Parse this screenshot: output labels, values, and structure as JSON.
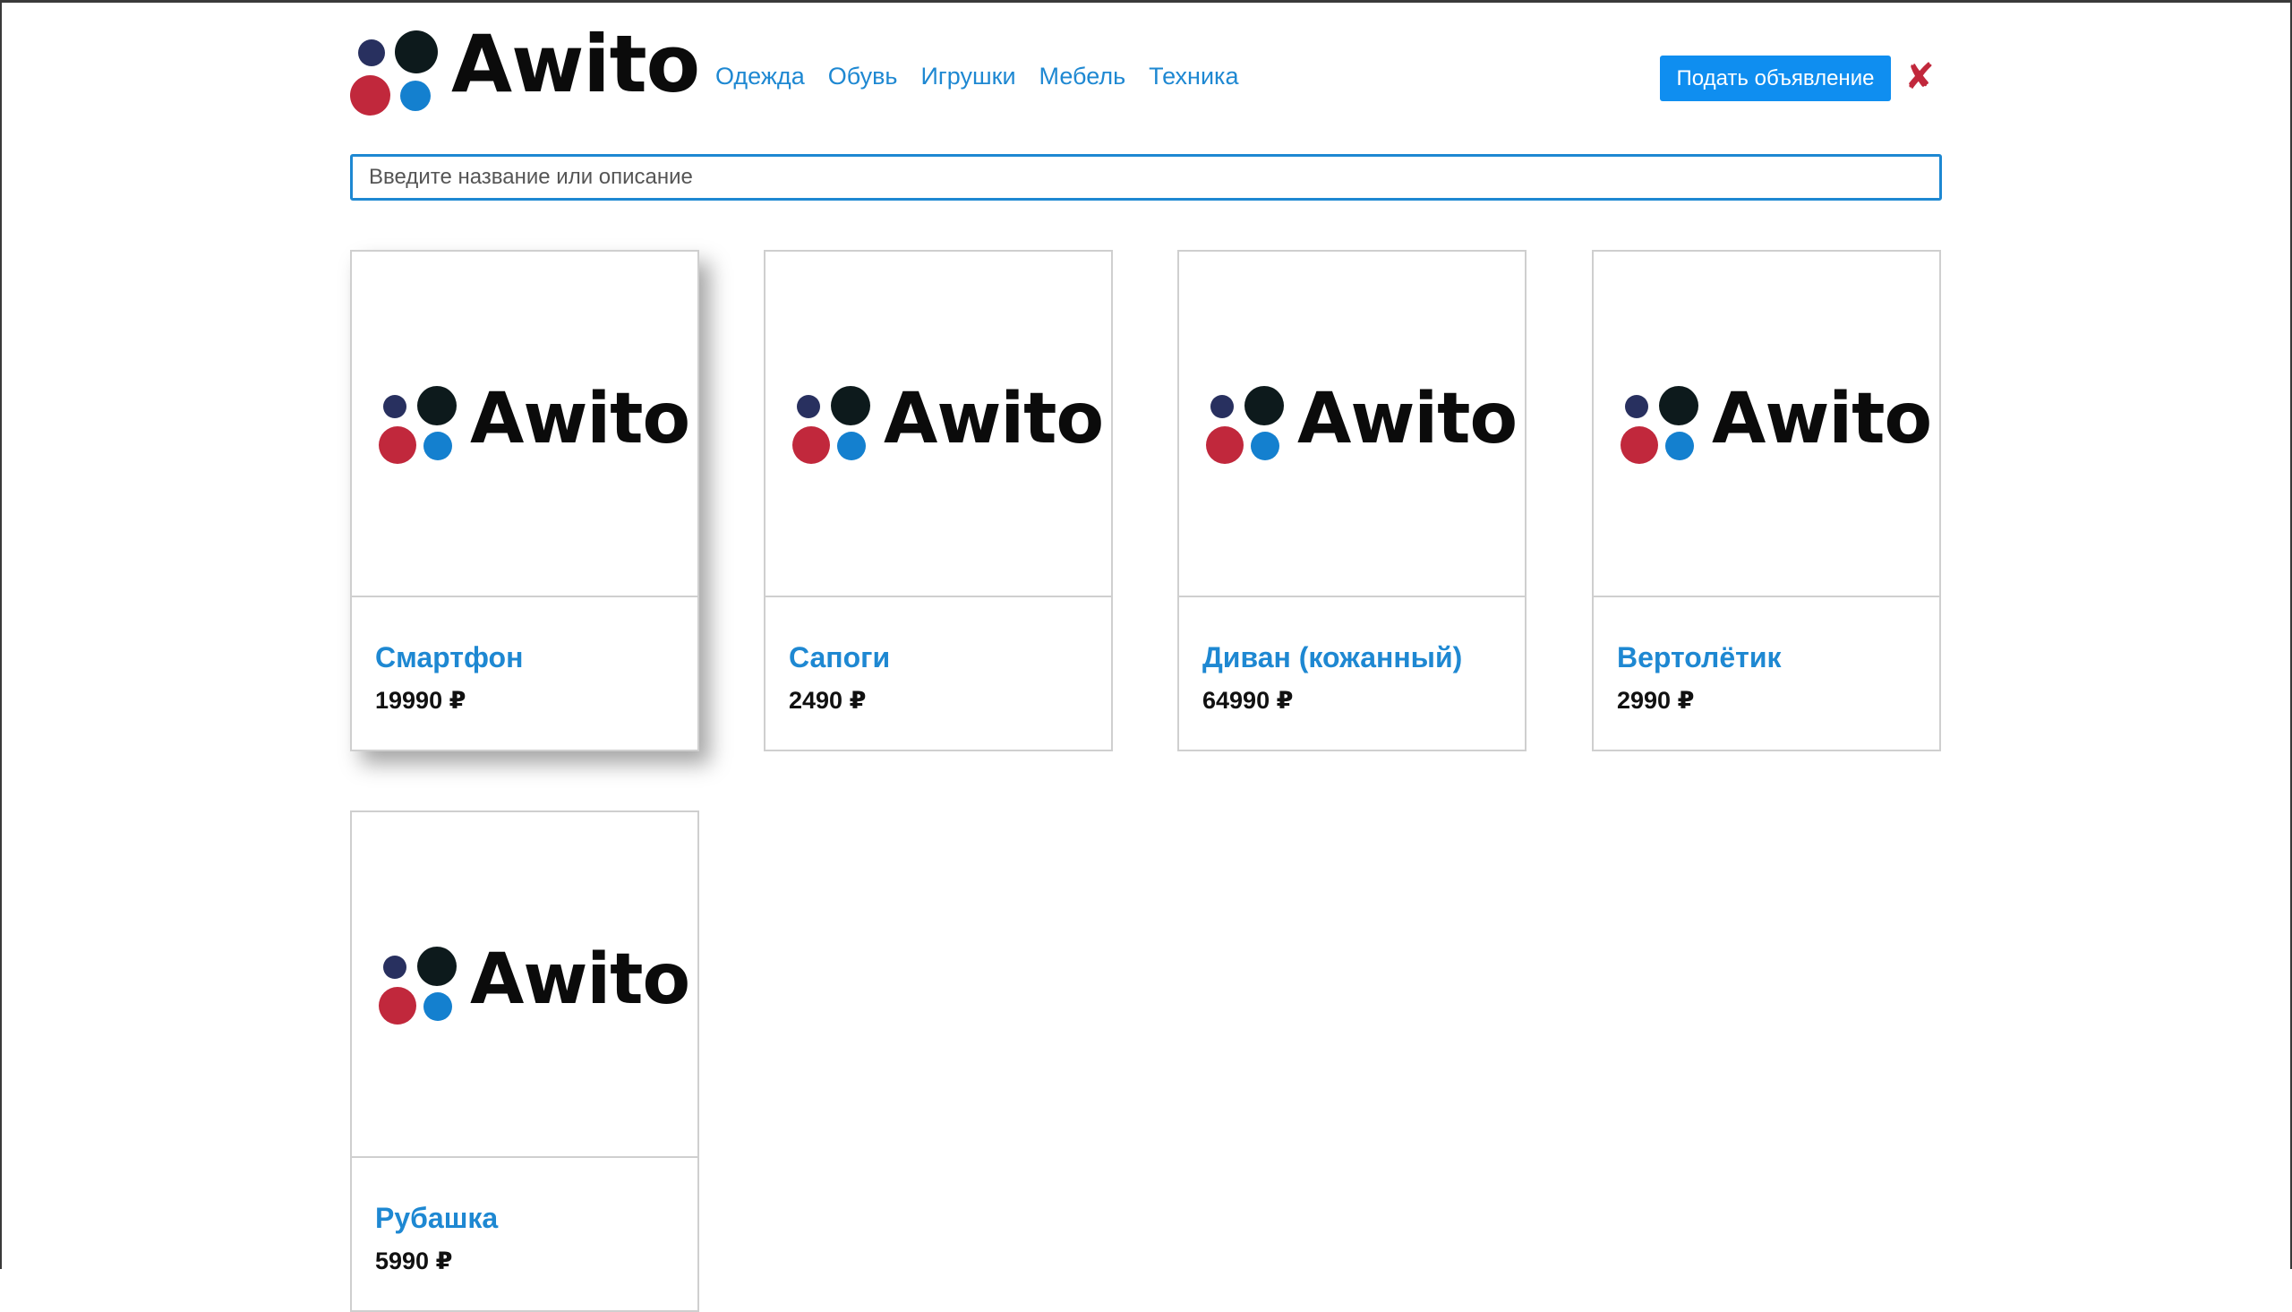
{
  "colors": {
    "accent": "#1e88d2",
    "button": "#0f8ef0",
    "close": "#c1283c",
    "logo_dot_navy": "#28305f",
    "logo_dot_black": "#0d1a1c",
    "logo_dot_red": "#c1283c",
    "logo_dot_blue": "#1480cf"
  },
  "header": {
    "logo_text": "Awito",
    "nav": [
      "Одежда",
      "Обувь",
      "Игрушки",
      "Мебель",
      "Техника"
    ],
    "post_button_label": "Подать объявление",
    "close_icon": "✘"
  },
  "search": {
    "placeholder": "Введите название или описание"
  },
  "cards": [
    {
      "image_logo_text": "Awito",
      "title": "Смартфон",
      "price": "19990 ₽"
    },
    {
      "image_logo_text": "Awito",
      "title": "Сапоги",
      "price": "2490 ₽"
    },
    {
      "image_logo_text": "Awito",
      "title": "Диван (кожанный)",
      "price": "64990 ₽"
    },
    {
      "image_logo_text": "Awito",
      "title": "Вертолётик",
      "price": "2990 ₽"
    },
    {
      "image_logo_text": "Awito",
      "title": "Рубашка",
      "price": "5990 ₽"
    }
  ]
}
